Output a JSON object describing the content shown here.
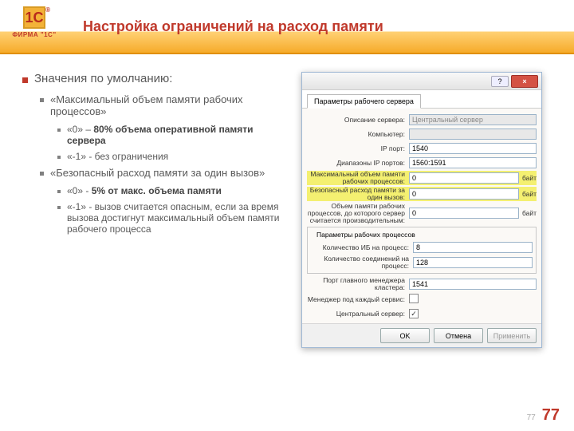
{
  "header": {
    "logo_text": "1С",
    "logo_sub": "ФИРМА \"1С\"",
    "title": "Настройка ограничений на расход памяти"
  },
  "bullets": {
    "top": "Значения по умолчанию:",
    "s1": "«Максимальный объем памяти рабочих процессов»",
    "s1a_pre": "«0» – ",
    "s1a_b": "80% объема оперативной памяти сервера",
    "s1b": "«-1» - без ограничения",
    "s2": "«Безопасный расход памяти за один вызов»",
    "s2a_pre": "«0» - ",
    "s2a_b": "5% от макс. объема памяти",
    "s2b": "«-1» - вызов считается опасным, если за время вызова достигнут максимальный объем памяти рабочего процесса"
  },
  "win": {
    "tab": "Параметры рабочего сервера",
    "rows": {
      "desc_lbl": "Описание сервера:",
      "desc_val": "Центральный сервер",
      "comp_lbl": "Компьютер:",
      "comp_val": "",
      "ipport_lbl": "IP порт:",
      "ipport_val": "1540",
      "range_lbl": "Диапазоны IP портов:",
      "range_val": "1560:1591",
      "maxmem_lbl": "Максимальный объем памяти рабочих процессов:",
      "maxmem_val": "0",
      "safemem_lbl": "Безопасный расход памяти за один вызов:",
      "safemem_val": "0",
      "perf_lbl": "Объем памяти рабочих процессов, до которого сервер считается производительным:",
      "perf_val": "0",
      "unit": "байт"
    },
    "group": {
      "title": "Параметры рабочих процессов",
      "ibcount_lbl": "Количество ИБ на процесс:",
      "ibcount_val": "8",
      "conn_lbl": "Количество соединений на процесс:",
      "conn_val": "128"
    },
    "cluster_lbl": "Порт главного менеджера кластера:",
    "cluster_val": "1541",
    "mgrserv_lbl": "Менеджер под каждый сервис:",
    "mgrserv_chk": "",
    "central_lbl": "Центральный сервер:",
    "central_chk": "✓",
    "buttons": {
      "ok": "OK",
      "cancel": "Отмена",
      "apply": "Применить"
    }
  },
  "page": {
    "small": "77",
    "big": "77"
  }
}
